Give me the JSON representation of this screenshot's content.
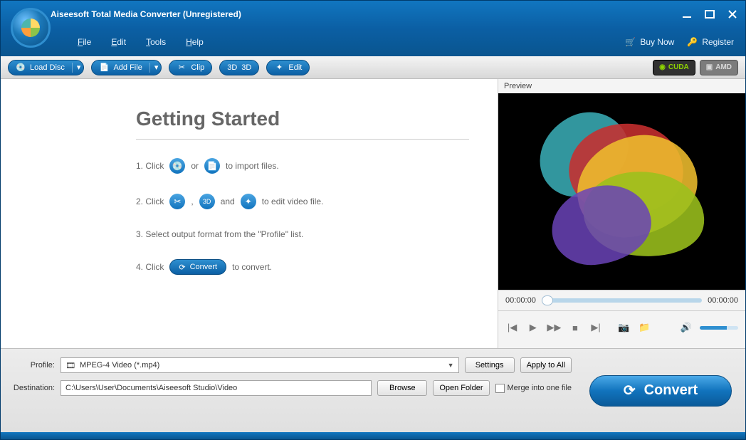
{
  "title": "Aiseesoft Total Media Converter (Unregistered)",
  "menu": {
    "file": "File",
    "edit": "Edit",
    "tools": "Tools",
    "help": "Help"
  },
  "menu_right": {
    "buy": "Buy Now",
    "register": "Register"
  },
  "toolbar": {
    "load_disc": "Load Disc",
    "add_file": "Add File",
    "clip": "Clip",
    "three_d": "3D",
    "edit": "Edit",
    "cuda": "CUDA",
    "amd": "AMD"
  },
  "getting_started": {
    "title": "Getting Started",
    "step1_a": "1. Click",
    "step1_b": "or",
    "step1_c": "to import files.",
    "step2_a": "2. Click",
    "step2_b": ",",
    "step2_c": "and",
    "step2_d": "to edit video file.",
    "step3": "3. Select output format from the \"Profile\" list.",
    "step4_a": "4. Click",
    "step4_btn": "Convert",
    "step4_b": "to convert."
  },
  "preview": {
    "label": "Preview",
    "time_start": "00:00:00",
    "time_end": "00:00:00"
  },
  "bottom": {
    "profile_label": "Profile:",
    "profile_value": "MPEG-4 Video (*.mp4)",
    "settings": "Settings",
    "apply_all": "Apply to All",
    "dest_label": "Destination:",
    "dest_value": "C:\\Users\\User\\Documents\\Aiseesoft Studio\\Video",
    "browse": "Browse",
    "open_folder": "Open Folder",
    "merge": "Merge into one file",
    "convert": "Convert"
  }
}
